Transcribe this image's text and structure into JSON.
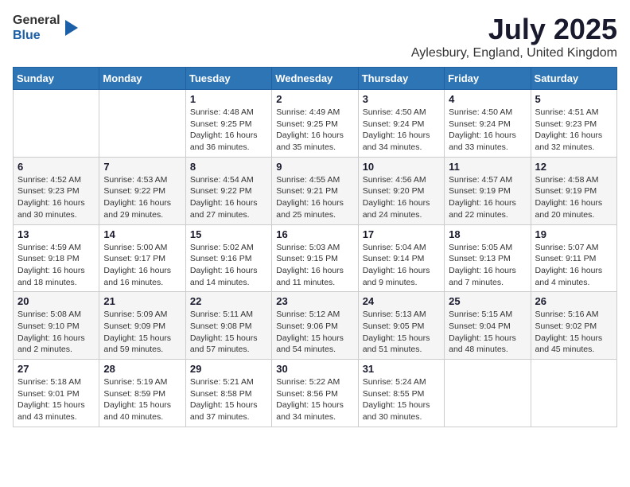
{
  "logo": {
    "general": "General",
    "blue": "Blue"
  },
  "header": {
    "title": "July 2025",
    "subtitle": "Aylesbury, England, United Kingdom"
  },
  "weekdays": [
    "Sunday",
    "Monday",
    "Tuesday",
    "Wednesday",
    "Thursday",
    "Friday",
    "Saturday"
  ],
  "weeks": [
    [
      {
        "day": "",
        "info": ""
      },
      {
        "day": "",
        "info": ""
      },
      {
        "day": "1",
        "info": "Sunrise: 4:48 AM\nSunset: 9:25 PM\nDaylight: 16 hours\nand 36 minutes."
      },
      {
        "day": "2",
        "info": "Sunrise: 4:49 AM\nSunset: 9:25 PM\nDaylight: 16 hours\nand 35 minutes."
      },
      {
        "day": "3",
        "info": "Sunrise: 4:50 AM\nSunset: 9:24 PM\nDaylight: 16 hours\nand 34 minutes."
      },
      {
        "day": "4",
        "info": "Sunrise: 4:50 AM\nSunset: 9:24 PM\nDaylight: 16 hours\nand 33 minutes."
      },
      {
        "day": "5",
        "info": "Sunrise: 4:51 AM\nSunset: 9:23 PM\nDaylight: 16 hours\nand 32 minutes."
      }
    ],
    [
      {
        "day": "6",
        "info": "Sunrise: 4:52 AM\nSunset: 9:23 PM\nDaylight: 16 hours\nand 30 minutes."
      },
      {
        "day": "7",
        "info": "Sunrise: 4:53 AM\nSunset: 9:22 PM\nDaylight: 16 hours\nand 29 minutes."
      },
      {
        "day": "8",
        "info": "Sunrise: 4:54 AM\nSunset: 9:22 PM\nDaylight: 16 hours\nand 27 minutes."
      },
      {
        "day": "9",
        "info": "Sunrise: 4:55 AM\nSunset: 9:21 PM\nDaylight: 16 hours\nand 25 minutes."
      },
      {
        "day": "10",
        "info": "Sunrise: 4:56 AM\nSunset: 9:20 PM\nDaylight: 16 hours\nand 24 minutes."
      },
      {
        "day": "11",
        "info": "Sunrise: 4:57 AM\nSunset: 9:19 PM\nDaylight: 16 hours\nand 22 minutes."
      },
      {
        "day": "12",
        "info": "Sunrise: 4:58 AM\nSunset: 9:19 PM\nDaylight: 16 hours\nand 20 minutes."
      }
    ],
    [
      {
        "day": "13",
        "info": "Sunrise: 4:59 AM\nSunset: 9:18 PM\nDaylight: 16 hours\nand 18 minutes."
      },
      {
        "day": "14",
        "info": "Sunrise: 5:00 AM\nSunset: 9:17 PM\nDaylight: 16 hours\nand 16 minutes."
      },
      {
        "day": "15",
        "info": "Sunrise: 5:02 AM\nSunset: 9:16 PM\nDaylight: 16 hours\nand 14 minutes."
      },
      {
        "day": "16",
        "info": "Sunrise: 5:03 AM\nSunset: 9:15 PM\nDaylight: 16 hours\nand 11 minutes."
      },
      {
        "day": "17",
        "info": "Sunrise: 5:04 AM\nSunset: 9:14 PM\nDaylight: 16 hours\nand 9 minutes."
      },
      {
        "day": "18",
        "info": "Sunrise: 5:05 AM\nSunset: 9:13 PM\nDaylight: 16 hours\nand 7 minutes."
      },
      {
        "day": "19",
        "info": "Sunrise: 5:07 AM\nSunset: 9:11 PM\nDaylight: 16 hours\nand 4 minutes."
      }
    ],
    [
      {
        "day": "20",
        "info": "Sunrise: 5:08 AM\nSunset: 9:10 PM\nDaylight: 16 hours\nand 2 minutes."
      },
      {
        "day": "21",
        "info": "Sunrise: 5:09 AM\nSunset: 9:09 PM\nDaylight: 15 hours\nand 59 minutes."
      },
      {
        "day": "22",
        "info": "Sunrise: 5:11 AM\nSunset: 9:08 PM\nDaylight: 15 hours\nand 57 minutes."
      },
      {
        "day": "23",
        "info": "Sunrise: 5:12 AM\nSunset: 9:06 PM\nDaylight: 15 hours\nand 54 minutes."
      },
      {
        "day": "24",
        "info": "Sunrise: 5:13 AM\nSunset: 9:05 PM\nDaylight: 15 hours\nand 51 minutes."
      },
      {
        "day": "25",
        "info": "Sunrise: 5:15 AM\nSunset: 9:04 PM\nDaylight: 15 hours\nand 48 minutes."
      },
      {
        "day": "26",
        "info": "Sunrise: 5:16 AM\nSunset: 9:02 PM\nDaylight: 15 hours\nand 45 minutes."
      }
    ],
    [
      {
        "day": "27",
        "info": "Sunrise: 5:18 AM\nSunset: 9:01 PM\nDaylight: 15 hours\nand 43 minutes."
      },
      {
        "day": "28",
        "info": "Sunrise: 5:19 AM\nSunset: 8:59 PM\nDaylight: 15 hours\nand 40 minutes."
      },
      {
        "day": "29",
        "info": "Sunrise: 5:21 AM\nSunset: 8:58 PM\nDaylight: 15 hours\nand 37 minutes."
      },
      {
        "day": "30",
        "info": "Sunrise: 5:22 AM\nSunset: 8:56 PM\nDaylight: 15 hours\nand 34 minutes."
      },
      {
        "day": "31",
        "info": "Sunrise: 5:24 AM\nSunset: 8:55 PM\nDaylight: 15 hours\nand 30 minutes."
      },
      {
        "day": "",
        "info": ""
      },
      {
        "day": "",
        "info": ""
      }
    ]
  ]
}
